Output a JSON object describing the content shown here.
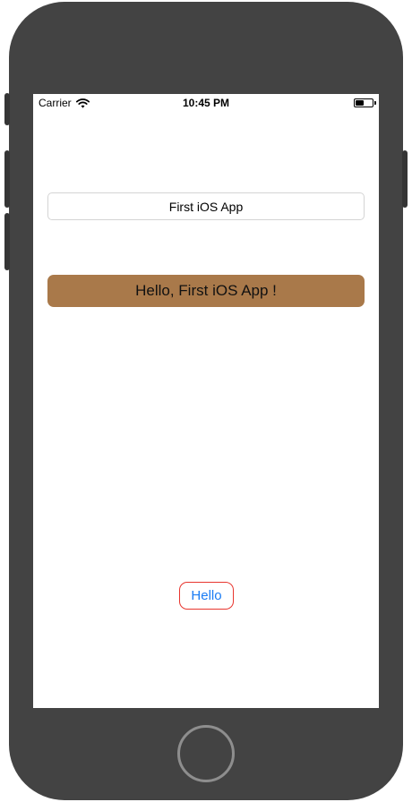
{
  "status_bar": {
    "carrier": "Carrier",
    "wifi_icon": "wifi-icon",
    "time": "10:45 PM",
    "battery_icon": "battery-icon",
    "battery_level": 0.5
  },
  "main": {
    "text_field": {
      "value": "First iOS App"
    },
    "greeting_label": "Hello, First iOS App !",
    "hello_button_label": "Hello"
  },
  "device": {
    "home_button_icon": "home-button-icon"
  },
  "colors": {
    "device_body": "#434343",
    "greeting_background": "#a9794a",
    "button_border": "#e8352e",
    "button_text": "#1a7cf4"
  }
}
